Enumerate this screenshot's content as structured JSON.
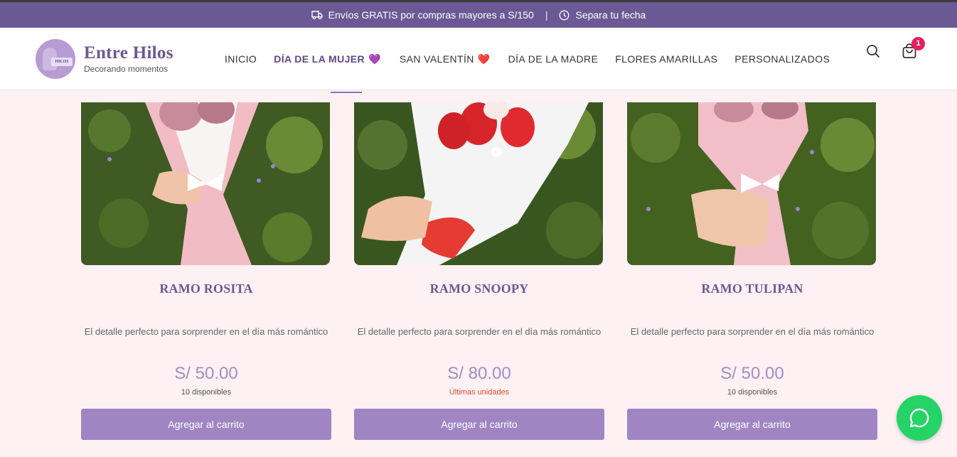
{
  "topbar": {
    "shipping_text": "Envíos GRATIS por compras mayores a S/150",
    "separator": "|",
    "date_text": "Separa tu fecha"
  },
  "brand": {
    "name": "Entre Hilos",
    "tagline": "Decorando momentos",
    "logo_tag": "HILOS"
  },
  "nav": {
    "items": [
      {
        "label": "INICIO"
      },
      {
        "label": "DÍA DE LA MUJER",
        "icon": "purple-heart",
        "active": true
      },
      {
        "label": "SAN VALENTÍN",
        "icon": "red-heart"
      },
      {
        "label": "DÍA DE LA MADRE"
      },
      {
        "label": "FLORES AMARILLAS"
      },
      {
        "label": "PERSONALIZADOS"
      }
    ],
    "heart_purple": "💜",
    "heart_red": "❤️"
  },
  "cart": {
    "count": "1"
  },
  "products": [
    {
      "title": "RAMO ROSITA",
      "description": "El detalle perfecto para sorprender en el día más romántico",
      "price": "S/ 50.00",
      "stock": "10 disponibles",
      "button": "Agregar al carrito"
    },
    {
      "title": "RAMO SNOOPY",
      "description": "El detalle perfecto para sorprender en el día más romántico",
      "price": "S/ 80.00",
      "stock": "Últimas unidades",
      "button": "Agregar al carrito"
    },
    {
      "title": "RAMO TULIPAN",
      "description": "El detalle perfecto para sorprender en el día más romántico",
      "price": "S/ 50.00",
      "stock": "10 disponibles",
      "button": "Agregar al carrito"
    }
  ],
  "colors": {
    "brand": "#6a5995",
    "button": "#9f86c2",
    "price": "#a58cc3",
    "low_stock": "#d9502d",
    "badge": "#e51e60",
    "whatsapp": "#25d366"
  }
}
